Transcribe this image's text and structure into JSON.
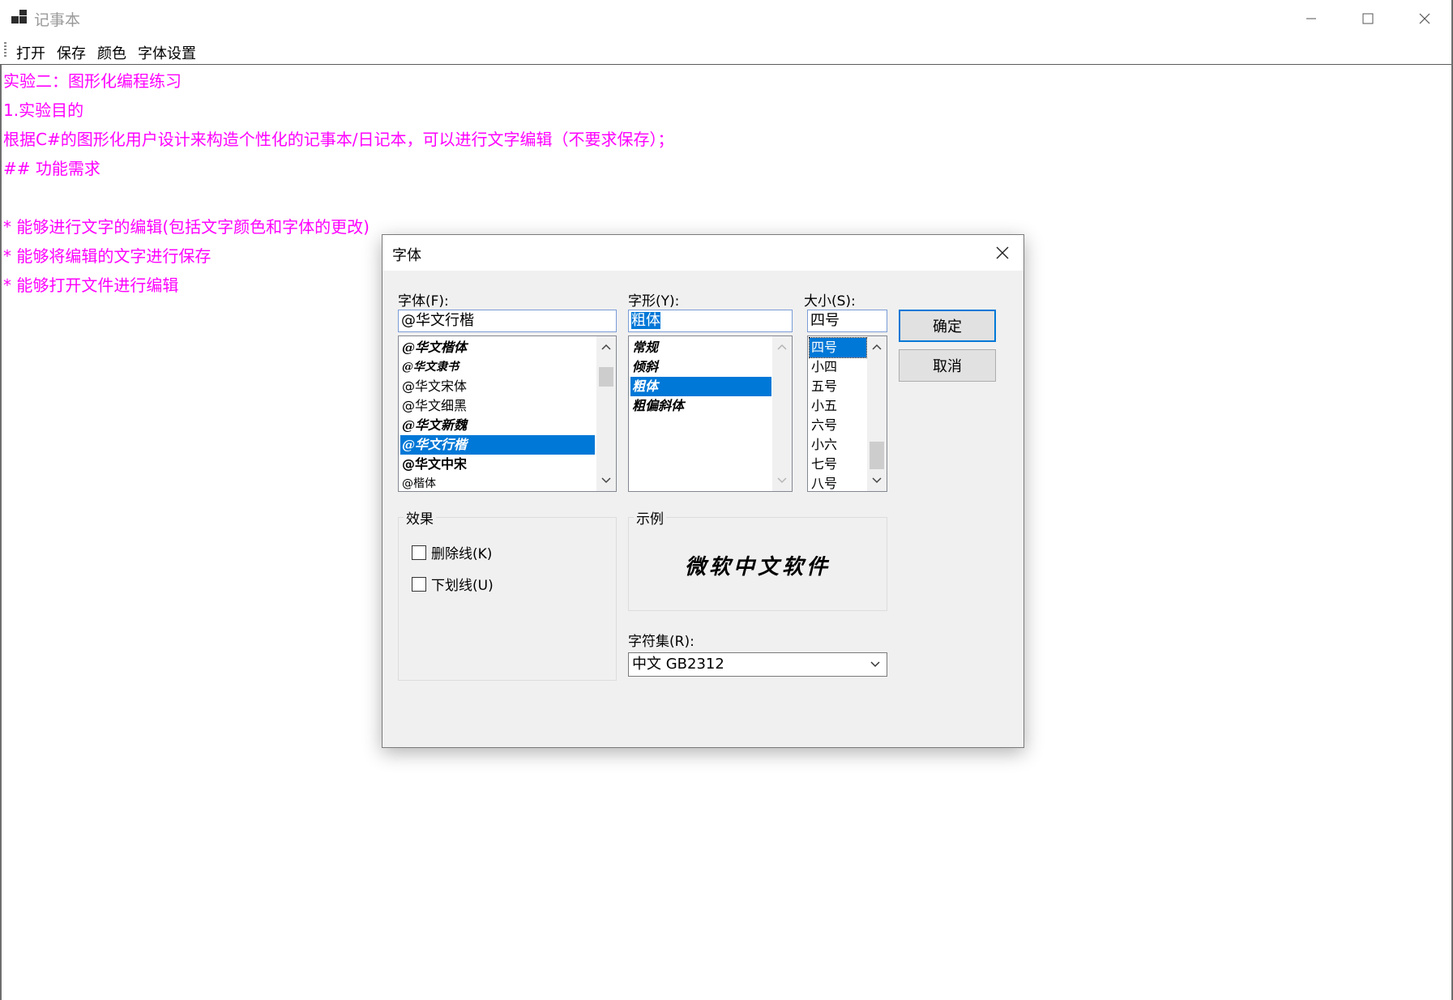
{
  "window": {
    "title": "记事本"
  },
  "menu": {
    "items": [
      "打开",
      "保存",
      "颜色",
      "字体设置"
    ]
  },
  "editor": {
    "text_color": "#ff00ff",
    "lines": [
      "实验二：图形化编程练习",
      "1.实验目的",
      "根据C#的图形化用户设计来构造个性化的记事本/日记本，可以进行文字编辑（不要求保存）；",
      "## 功能需求",
      "",
      "* 能够进行文字的编辑(包括文字颜色和字体的更改)",
      "* 能够将编辑的文字进行保存",
      "* 能够打开文件进行编辑"
    ]
  },
  "font_dialog": {
    "title": "字体",
    "font": {
      "label": "字体(F):",
      "value": "@华文行楷",
      "items": [
        "@华文楷体",
        "@华文隶书",
        "@华文宋体",
        "@华文细黑",
        "@华文新魏",
        "@华文行楷",
        "@华文中宋",
        "@楷体"
      ],
      "selected_index": 5
    },
    "style": {
      "label": "字形(Y):",
      "value": "粗体",
      "items": [
        "常规",
        "倾斜",
        "粗体",
        "粗偏斜体"
      ],
      "selected_index": 2
    },
    "size": {
      "label": "大小(S):",
      "value": "四号",
      "items": [
        "四号",
        "小四",
        "五号",
        "小五",
        "六号",
        "小六",
        "七号",
        "八号"
      ],
      "selected_index": 0
    },
    "ok_label": "确定",
    "cancel_label": "取消",
    "effects": {
      "label": "效果",
      "strikeout": "删除线(K)",
      "underline": "下划线(U)"
    },
    "sample": {
      "label": "示例",
      "text": "微软中文软件"
    },
    "charset": {
      "label": "字符集(R):",
      "value": "中文 GB2312"
    },
    "accent_color": "#0078d7"
  }
}
